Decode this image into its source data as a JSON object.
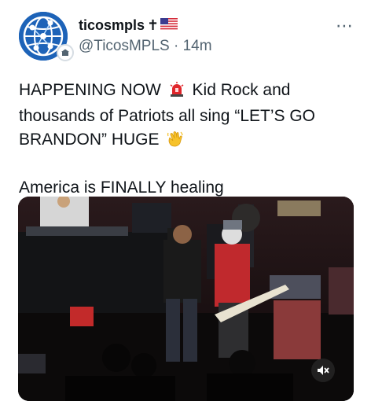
{
  "tweet": {
    "display_name": "ticosmpls",
    "name_suffix": "✝",
    "handle": "@TicosMPLS",
    "separator": "·",
    "time": "14m",
    "more_icon": "more-horizontal-icon",
    "text_line1_a": "HAPPENING NOW",
    "text_line1_b": "Kid Rock and",
    "text_line2": "thousands of Patriots all sing “LET’S GO",
    "text_line3": "BRANDON” HUGE",
    "text_line4": "America is FINALLY healing",
    "siren_icon": "police-siren-icon",
    "clap_icon": "waving-hand-icon",
    "flag_icon": "us-flag-icon"
  },
  "media": {
    "type": "video",
    "mute_icon": "sound-off-icon"
  },
  "colors": {
    "text": "#0f1419",
    "secondary": "#536471",
    "avatar_blue": "#1d63b8"
  }
}
